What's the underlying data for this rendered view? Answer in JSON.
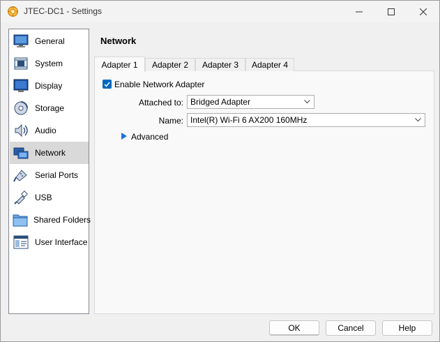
{
  "window": {
    "title": "JTEC-DC1 - Settings",
    "controls": {
      "minimize": "minimize",
      "maximize": "maximize",
      "close": "close"
    }
  },
  "sidebar": {
    "items": [
      {
        "label": "General",
        "icon": "general-icon"
      },
      {
        "label": "System",
        "icon": "system-icon"
      },
      {
        "label": "Display",
        "icon": "display-icon"
      },
      {
        "label": "Storage",
        "icon": "storage-icon"
      },
      {
        "label": "Audio",
        "icon": "audio-icon"
      },
      {
        "label": "Network",
        "icon": "network-icon",
        "selected": true
      },
      {
        "label": "Serial Ports",
        "icon": "serial-ports-icon"
      },
      {
        "label": "USB",
        "icon": "usb-icon"
      },
      {
        "label": "Shared Folders",
        "icon": "shared-folders-icon"
      },
      {
        "label": "User Interface",
        "icon": "user-interface-icon"
      }
    ]
  },
  "main": {
    "title": "Network",
    "tabs": [
      {
        "label": "Adapter 1",
        "active": true
      },
      {
        "label": "Adapter 2"
      },
      {
        "label": "Adapter 3"
      },
      {
        "label": "Adapter 4"
      }
    ],
    "enable_adapter": {
      "label": "Enable Network Adapter",
      "checked": true
    },
    "attached_to": {
      "label": "Attached to:",
      "value": "Bridged Adapter"
    },
    "name": {
      "label": "Name:",
      "value": "Intel(R) Wi-Fi 6 AX200 160MHz"
    },
    "advanced": {
      "label": "Advanced"
    }
  },
  "buttons": {
    "ok": "OK",
    "cancel": "Cancel",
    "help": "Help"
  },
  "colors": {
    "accent": "#0067c0",
    "selected_bg": "#d9d9d9",
    "window_bg": "#f0f0f0"
  }
}
